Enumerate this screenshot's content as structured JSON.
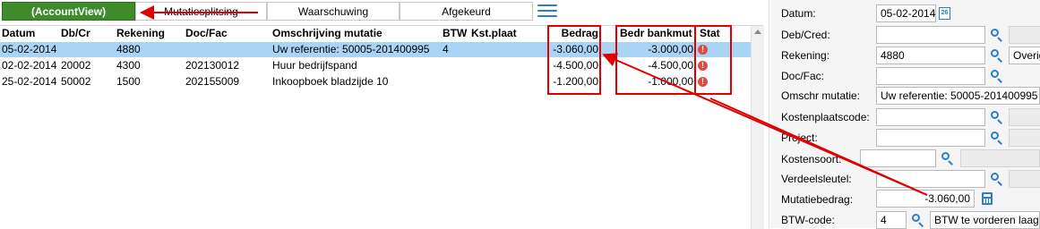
{
  "tabs": [
    {
      "label": "(AccountView)",
      "active": true
    },
    {
      "label": "Mutatiesplitsing",
      "active": false
    },
    {
      "label": "Waarschuwing",
      "active": false
    },
    {
      "label": "Afgekeurd",
      "active": false
    }
  ],
  "grid": {
    "columns": [
      "Datum",
      "Db/Cr",
      "Rekening",
      "Doc/Fac",
      "Omschrijving mutatie",
      "BTW",
      "Kst.plaat",
      "Bedrag",
      "Bedr bankmut",
      "Stat"
    ],
    "rows": [
      {
        "datum": "05-02-2014",
        "dbcr": "",
        "rekening": "4880",
        "docfac": "",
        "omschrijving": "Uw referentie:  50005-201400995",
        "btw": "4",
        "kstplaat": "",
        "bedrag": "-3.060,00",
        "bedr_bankmut": "-3.000,00",
        "stat": "!",
        "selected": true
      },
      {
        "datum": "02-02-2014",
        "dbcr": "20002",
        "rekening": "4300",
        "docfac": "202130012",
        "omschrijving": "Huur bedrijfspand",
        "btw": "",
        "kstplaat": "",
        "bedrag": "-4.500,00",
        "bedr_bankmut": "-4.500,00",
        "stat": "!",
        "selected": false
      },
      {
        "datum": "25-02-2014",
        "dbcr": "50002",
        "rekening": "1500",
        "docfac": "202155009",
        "omschrijving": "Inkoopboek bladzijde 10",
        "btw": "",
        "kstplaat": "",
        "bedrag": "-1.200,00",
        "bedr_bankmut": "-1.000,00",
        "stat": "!",
        "selected": false
      }
    ]
  },
  "form": {
    "datum": {
      "label": "Datum:",
      "value": "05-02-2014"
    },
    "debcred": {
      "label": "Deb/Cred:",
      "value": ""
    },
    "rekening": {
      "label": "Rekening:",
      "value": "4880",
      "extra": "Overig"
    },
    "docfac": {
      "label": "Doc/Fac:",
      "value": ""
    },
    "omschr": {
      "label": "Omschr mutatie:",
      "value": "Uw referentie:  50005-201400995"
    },
    "kostenplaats": {
      "label": "Kostenplaatscode:",
      "value": ""
    },
    "project": {
      "label": "Project:",
      "value": ""
    },
    "kostensoort": {
      "label": "Kostensoort:",
      "value": ""
    },
    "verdeel": {
      "label": "Verdeelsleutel:",
      "value": ""
    },
    "mutatiebedrag": {
      "label": "Mutatiebedrag:",
      "value": "-3.060,00"
    },
    "btwcode": {
      "label": "BTW-code:",
      "value": "4",
      "desc": "BTW te vorderen laag"
    }
  },
  "colors": {
    "accent": "#2b7dd3",
    "active_tab": "#3d8b2a",
    "selection": "#a9d4f5",
    "annotation": "#e00000",
    "status": "#e04a3f"
  }
}
